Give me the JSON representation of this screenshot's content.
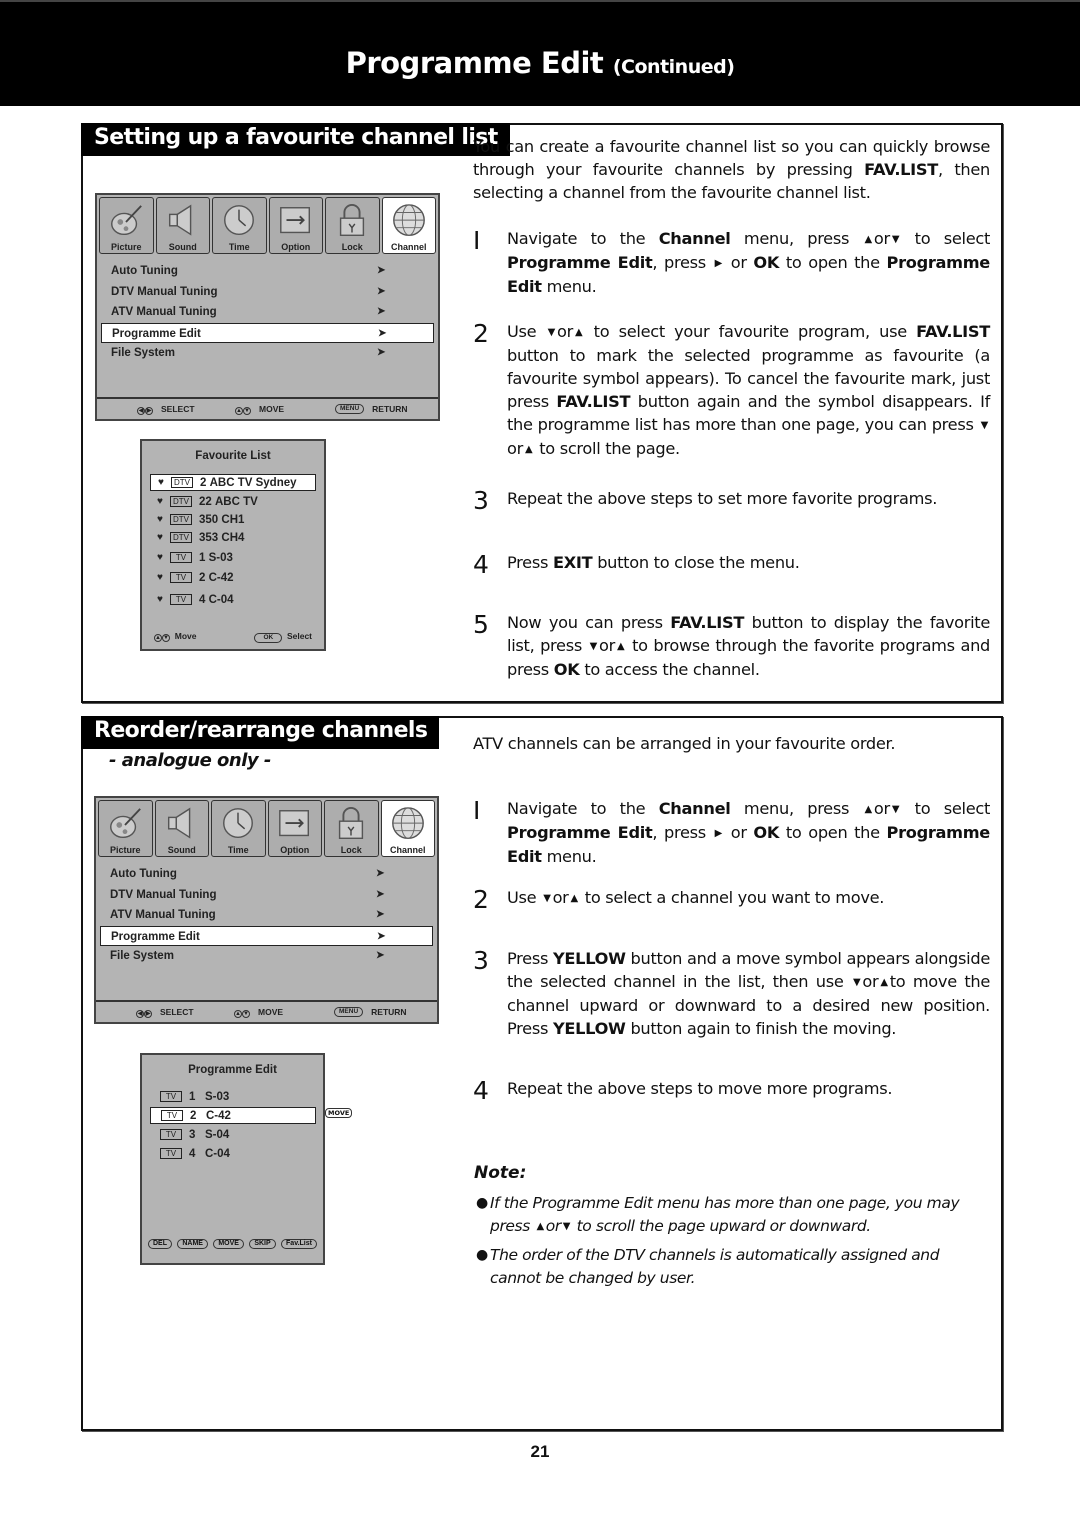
{
  "header": {
    "title": "Programme Edit",
    "subtitle": "(Continued)"
  },
  "section1": {
    "heading": "Setting up a favourite channel list",
    "osd": {
      "tabs": [
        {
          "label": "Picture",
          "icon": "picture-icon",
          "active": false
        },
        {
          "label": "Sound",
          "icon": "speaker-icon",
          "active": false
        },
        {
          "label": "Time",
          "icon": "clock-icon",
          "active": false
        },
        {
          "label": "Option",
          "icon": "wrench-icon",
          "active": false
        },
        {
          "label": "Lock",
          "icon": "lock-icon",
          "active": false
        },
        {
          "label": "Channel",
          "icon": "globe-icon",
          "active": true
        }
      ],
      "items": [
        {
          "label": "Auto Tuning",
          "selected": false
        },
        {
          "label": "DTV Manual Tuning",
          "selected": false
        },
        {
          "label": "ATV Manual Tuning",
          "selected": false
        },
        {
          "label": "Programme Edit",
          "selected": true
        },
        {
          "label": "File System",
          "selected": false
        }
      ],
      "footer": {
        "select": "SELECT",
        "move": "MOVE",
        "menu_key": "MENU",
        "return": "RETURN"
      }
    },
    "fav_list": {
      "title": "Favourite List",
      "rows": [
        {
          "src": "DTV",
          "num": "2",
          "name": "ABC TV Sydney",
          "selected": true
        },
        {
          "src": "DTV",
          "num": "22",
          "name": "ABC TV",
          "selected": false
        },
        {
          "src": "DTV",
          "num": "350",
          "name": "CH1",
          "selected": false
        },
        {
          "src": "DTV",
          "num": "353",
          "name": "CH4",
          "selected": false
        },
        {
          "src": "TV",
          "num": "1",
          "name": "S-03",
          "selected": false
        },
        {
          "src": "TV",
          "num": "2",
          "name": "C-42",
          "selected": false
        },
        {
          "src": "TV",
          "num": "4",
          "name": "C-04",
          "selected": false
        }
      ],
      "footer": {
        "move": "Move",
        "ok_key": "OK",
        "select": "Select"
      }
    },
    "intro": "You can create a favourite channel list so you can quickly browse through your favourite channels by pressing FAV.LIST, then selecting a channel from the favourite channel list.",
    "steps": [
      {
        "num": "1",
        "text": "Navigate to the Channel menu, press ▲or▼ to select Programme Edit, press ▶ or OK to open the Programme Edit menu."
      },
      {
        "num": "2",
        "text": "Use ▼or▲ to select your favourite program, use FAV.LIST button to mark the selected programme as favourite (a favourite symbol appears). To cancel the favourite mark, just press FAV.LIST button again and the symbol disappears. If the programme list has more than one page, you can press ▼or▲ to scroll the page."
      },
      {
        "num": "3",
        "text": "Repeat the above steps to set more favorite programs."
      },
      {
        "num": "4",
        "text": "Press EXIT button to close the menu."
      },
      {
        "num": "5",
        "text": "Now you can press FAV.LIST button to display the favorite list, press ▼or▲ to browse through the favorite programs and press OK to access the channel."
      }
    ]
  },
  "section2": {
    "heading": "Reorder/rearrange channels",
    "subheading": "- analogue only -",
    "osd": {
      "items": [
        {
          "label": "Auto Tuning"
        },
        {
          "label": "DTV Manual Tuning"
        },
        {
          "label": "ATV Manual Tuning"
        },
        {
          "label": "Programme Edit"
        },
        {
          "label": "File System"
        }
      ]
    },
    "prog_edit": {
      "title": "Programme Edit",
      "rows": [
        {
          "src": "TV",
          "num": "1",
          "name": "S-03",
          "selected": false
        },
        {
          "src": "TV",
          "num": "2",
          "name": "C-42",
          "selected": true
        },
        {
          "src": "TV",
          "num": "3",
          "name": "S-04",
          "selected": false
        },
        {
          "src": "TV",
          "num": "4",
          "name": "C-04",
          "selected": false
        }
      ],
      "move_tag": "MOVE",
      "buttons": [
        "DEL",
        "NAME",
        "MOVE",
        "SKIP",
        "Fav.List"
      ]
    },
    "intro": "ATV channels can be arranged in your favourite order.",
    "steps": [
      {
        "num": "1",
        "text": "Navigate to the Channel menu, press ▲or▼ to select Programme Edit, press ▶ or OK to open the Programme Edit menu."
      },
      {
        "num": "2",
        "text": "Use ▼or▲ to select a channel you want to move."
      },
      {
        "num": "3",
        "text": "Press YELLOW button and a move symbol appears alongside the selected channel in the list, then use ▼or▲to move the channel upward or downward to a desired new position. Press YELLOW button again to finish the moving."
      },
      {
        "num": "4",
        "text": "Repeat the above steps to move more programs."
      }
    ],
    "note": {
      "heading": "Note:",
      "items": [
        "If the Programme Edit menu has more than one page, you may press ▲or▼ to scroll the page upward or downward.",
        "The order of the DTV channels is automatically assigned and cannot be changed by user."
      ]
    }
  },
  "page_number": "21"
}
